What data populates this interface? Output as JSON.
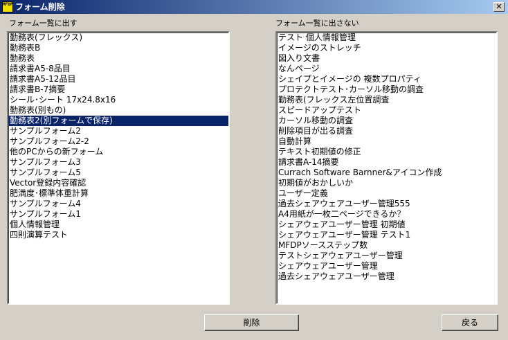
{
  "window": {
    "title": "フォーム削除",
    "icon_text": "MFDP",
    "close_symbol": "✕"
  },
  "left": {
    "label": "フォーム一覧に出す",
    "items": [
      "勤務表(フレックス)",
      "勤務表B",
      "勤務表",
      "請求書A5-8品目",
      "請求書A5-12品目",
      "請求書B-7摘要",
      "シール･シート 17x24.8x16",
      "勤務表(別もの)",
      "勤務表2(別フォームで保存)",
      "サンプルフォーム2",
      "サンプルフォーム2-2",
      "他のPCからの新フォーム",
      "サンプルフォーム3",
      "サンプルフォーム5",
      "Vector登録内容確認",
      "肥満度･標準体重計算",
      "サンプルフォーム4",
      "サンプルフォーム1",
      "個人情報管理",
      "四則演算テスト"
    ],
    "selected_index": 8
  },
  "right": {
    "label": "フォーム一覧に出さない",
    "items": [
      "テスト 個人情報管理",
      "イメージのストレッチ",
      "図入り文書",
      "なんページ",
      "シェイプとイメージの 複数プロパティ",
      "プロテクトテスト･カーソル移動の調査",
      "勤務表(フレックス左位置調査",
      "スピードアップテスト",
      "カーソル移動の調査",
      "削除項目が出る調査",
      "自動計算",
      "テキスト初期値の修正",
      "請求書A-14摘要",
      "Currach Software Barnner&アイコン作成",
      "初期値がおかしいか",
      "ユーザー定義",
      "過去シェアウェアユーザー管理555",
      "A4用紙が一枚二ページできるか？",
      "シェアウェアユーザー管理 初期値",
      "シェアウェアユーザー管理 テスト1",
      "MFDPソースステップ数",
      "テストシェアウェアユーザー管理",
      "シェアウェアユーザー管理",
      "過去シェアウェアユーザー管理"
    ]
  },
  "buttons": {
    "delete": "削除",
    "back": "戻る"
  }
}
